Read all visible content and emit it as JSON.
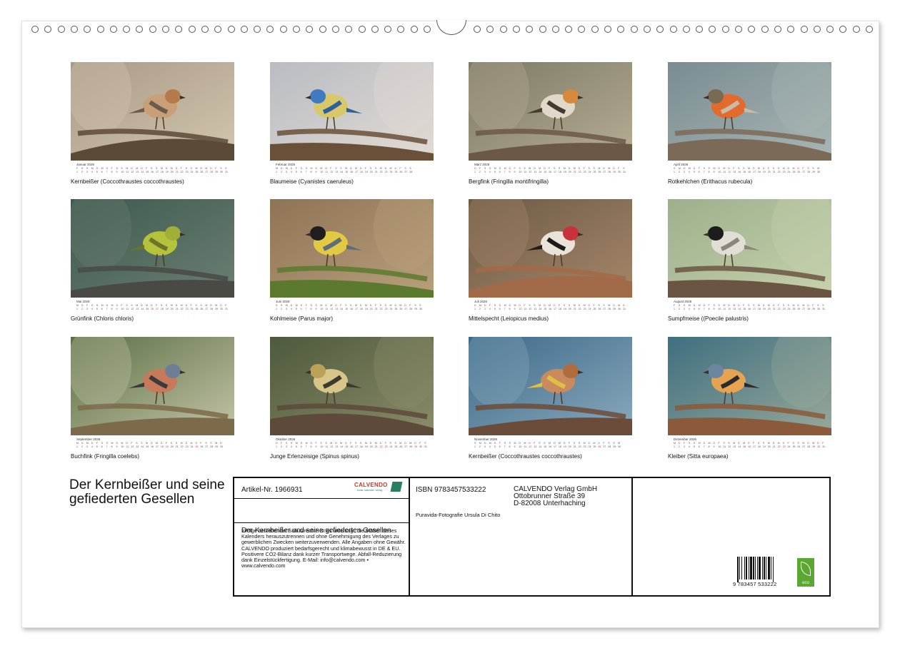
{
  "months": [
    {
      "label": "Januar 2026",
      "caption": "Kernbeißer  (Coccothraustes coccothraustes)",
      "days": 31,
      "scene": {
        "bg1": "#a89a86",
        "bg2": "#d3c6ae",
        "branch": "#5b4a36",
        "bird": "#c99f78",
        "head": "#b57a4a",
        "acc": "#6b5b4a"
      }
    },
    {
      "label": "Februar 2026",
      "caption": "Blaumeise (Cyanistes caeruleus)",
      "days": 28,
      "scene": {
        "bg1": "#b9bcc3",
        "bg2": "#e2dbd3",
        "branch": "#6a5038",
        "bird": "#d9c86a",
        "head": "#3f7bc0",
        "acc": "#2d5f9a"
      }
    },
    {
      "label": "März 2026",
      "caption": "Bergfink (Fringilla montifringilla)",
      "days": 31,
      "scene": {
        "bg1": "#7c7a64",
        "bg2": "#b6ad94",
        "branch": "#6b5847",
        "bird": "#e0d8c8",
        "head": "#d78a3b",
        "acc": "#433a30"
      }
    },
    {
      "label": "April 2026",
      "caption": "Rotkehlchen (Erithacus rubecula)",
      "days": 30,
      "scene": {
        "bg1": "#7a8c91",
        "bg2": "#a9b6b5",
        "branch": "#7c6a58",
        "bird": "#e26a2c",
        "head": "#7a6a52",
        "acc": "#c9bba5"
      }
    },
    {
      "label": "Mai 2026",
      "caption": "Grünfink (Chloris chloris)",
      "days": 31,
      "scene": {
        "bg1": "#3d5a4e",
        "bg2": "#6c7f72",
        "branch": "#4a4a45",
        "bird": "#b6c23c",
        "head": "#a1ae37",
        "acc": "#6a7528"
      }
    },
    {
      "label": "Juni 2026",
      "caption": "Kohlmeise (Parus major)",
      "days": 30,
      "scene": {
        "bg1": "#8e7456",
        "bg2": "#b9a07c",
        "branch": "#5b7a2f",
        "bird": "#e2c944",
        "head": "#1e1e1e",
        "acc": "#5e6d7a"
      }
    },
    {
      "label": "Juli 2026",
      "caption": "Mittelspecht (Leiopicus medius)",
      "days": 31,
      "scene": {
        "bg1": "#6d5a44",
        "bg2": "#a5876a",
        "branch": "#a26a48",
        "bird": "#e9e3da",
        "head": "#c9313d",
        "acc": "#1c1c1c"
      }
    },
    {
      "label": "August 2026",
      "caption": "Sumpfmeise ((Poecile palustris)",
      "days": 31,
      "scene": {
        "bg1": "#9db08b",
        "bg2": "#c7d1ae",
        "branch": "#6b5542",
        "bird": "#e1ded6",
        "head": "#1d1d1d",
        "acc": "#8d857b"
      }
    },
    {
      "label": "September 2026",
      "caption": "Buchfink (Fringilla coelebs)",
      "days": 30,
      "scene": {
        "bg1": "#5b7044",
        "bg2": "#c4c4a8",
        "branch": "#7d6a4a",
        "bird": "#c77a5a",
        "head": "#6e7f95",
        "acc": "#3b3b3b"
      }
    },
    {
      "label": "Oktober 2026",
      "caption": "Junge Erlenzeisige (Spinus spinus)",
      "days": 31,
      "scene": {
        "bg1": "#4d5a3c",
        "bg2": "#8b8c6a",
        "branch": "#5d4a3a",
        "bird": "#d8c58a",
        "head": "#b9a256",
        "acc": "#3d3a2f"
      }
    },
    {
      "label": "November 2026",
      "caption": "Kernbeißer  (Coccothraustes coccothraustes)",
      "days": 30,
      "scene": {
        "bg1": "#3e6a88",
        "bg2": "#8aa9bd",
        "branch": "#6b4c3a",
        "bird": "#c98a5e",
        "head": "#b06b3e",
        "acc": "#e0c044"
      }
    },
    {
      "label": "Dezember 2026",
      "caption": "Kleiber (Sitta europaea)",
      "days": 31,
      "scene": {
        "bg1": "#3f6f80",
        "bg2": "#98a89a",
        "branch": "#8a5a3a",
        "bird": "#e6a452",
        "head": "#6d86a0",
        "acc": "#2b2b2b"
      }
    }
  ],
  "calendar_title": "Der Kernbeißer und seine gefiederten Gesellen",
  "info": {
    "article": "Artikel-Nr. 1966931",
    "logo": "CALVENDO",
    "logo_sub": "kunst. kalender. verlag.",
    "subtitle": "Der Kernbeißer und seine gefiederten Gesellen",
    "legal": "Infolge bestehender Schutzrechte ist es untersagt, die Blätter dieses Kalenders herauszutrennen und ohne Genehmigung des Verlages zu gewerblichen Zwecken weiterzuverwenden. Alle Angaben ohne Gewähr. CALVENDO produziert bedarfsgerecht und klimabewusst in DE & EU. Positivere CO2-Bilanz dank kurzer Transportwege. Abfall-Reduzierung dank Einzelstückfertigung. E-Mail: info@calvendo.com • www.calvendo.com",
    "isbn": "ISBN 9783457533222",
    "publisher_lines": [
      "CALVENDO Verlag GmbH",
      "Ottobrunner Straße 39",
      "D-82008 Unterhaching"
    ],
    "photographer": "Puravida-Fotografie Ursula Di Chito",
    "barcode_number": "9 783457 533222",
    "eco_label": "eco"
  }
}
